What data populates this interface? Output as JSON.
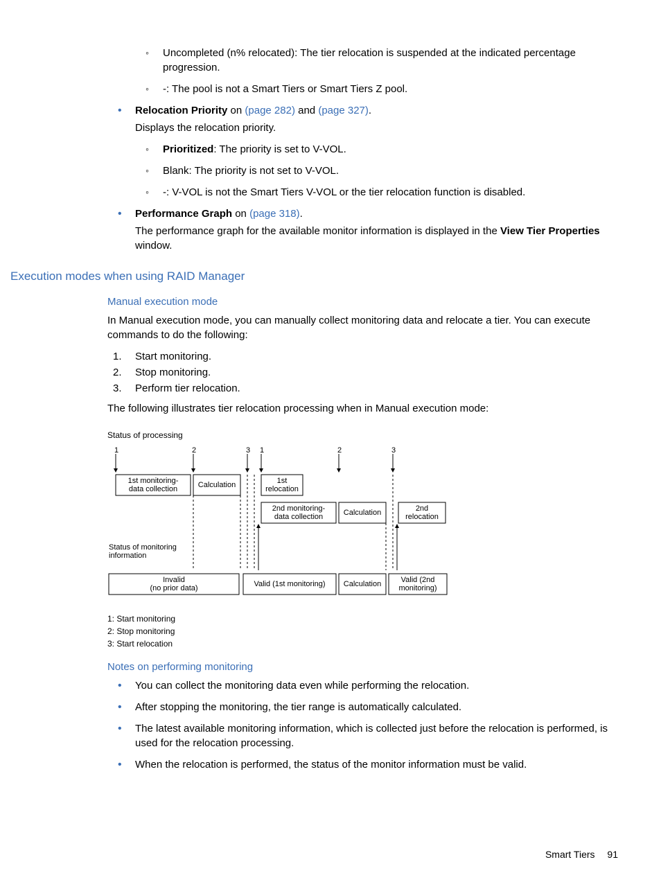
{
  "top_list": {
    "uncompleted": "Uncompleted (n% relocated): The tier relocation is suspended at the indicated percentage progression.",
    "dash_pool": "-: The pool is not a Smart Tiers or Smart Tiers Z pool."
  },
  "relocation_priority": {
    "label_bold": "Relocation Priority",
    "label_rest": " on ",
    "link1": "(page 282)",
    "and": " and ",
    "link2": "(page 327)",
    "dot": ".",
    "desc": "Displays the relocation priority.",
    "sub": {
      "prio_bold": "Prioritized",
      "prio_rest": ": The priority is set to V-VOL.",
      "blank": "Blank: The priority is not set to V-VOL.",
      "dash": "-: V-VOL is not the Smart Tiers V-VOL or the tier relocation function is disabled."
    }
  },
  "perf_graph": {
    "label_bold": "Performance Graph",
    "label_rest": " on ",
    "link": "(page 318)",
    "dot": ".",
    "desc_pre": "The performance graph for the available monitor information is displayed in the ",
    "desc_bold": "View Tier Properties",
    "desc_post": " window."
  },
  "exec_heading": "Execution modes when using RAID Manager",
  "manual": {
    "heading": "Manual execution mode",
    "intro": "In Manual execution mode, you can manually collect monitoring data and relocate a tier. You can execute commands to do the following:",
    "steps": {
      "n1": "1.",
      "s1": "Start monitoring.",
      "n2": "2.",
      "s2": "Stop monitoring.",
      "n3": "3.",
      "s3": "Perform tier relocation."
    },
    "followup": "The following illustrates tier relocation processing when in Manual execution mode:"
  },
  "diagram": {
    "caption": "Status of processing",
    "row1": {
      "box1a": "1st monitoring-",
      "box1b": "data collection",
      "box2": "Calculation",
      "box3a": "1st",
      "box3b": "relocation"
    },
    "row2": {
      "box1a": "2nd monitoring-",
      "box1b": "data collection",
      "box2": "Calculation",
      "box3a": "2nd",
      "box3b": "relocation"
    },
    "midlabel_a": "Status of monitoring",
    "midlabel_b": "information",
    "row3": {
      "b1a": "Invalid",
      "b1b": "(no prior data)",
      "b2": "Valid (1st monitoring)",
      "b3": "Calculation",
      "b4a": "Valid (2nd",
      "b4b": "monitoring)"
    },
    "ticks": {
      "t1": "1",
      "t2": "2",
      "t3": "3"
    },
    "legend": {
      "l1": "1: Start monitoring",
      "l2": "2: Stop monitoring",
      "l3": "3: Start relocation"
    }
  },
  "notes": {
    "heading": "Notes on performing monitoring",
    "n1": "You can collect the monitoring data even while performing the relocation.",
    "n2": "After stopping the monitoring, the tier range is automatically calculated.",
    "n3": "The latest available monitoring information, which is collected just before the relocation is performed, is used for the relocation processing.",
    "n4": "When the relocation is performed, the status of the monitor information must be valid."
  },
  "footer": {
    "section": "Smart Tiers",
    "page": "91"
  }
}
